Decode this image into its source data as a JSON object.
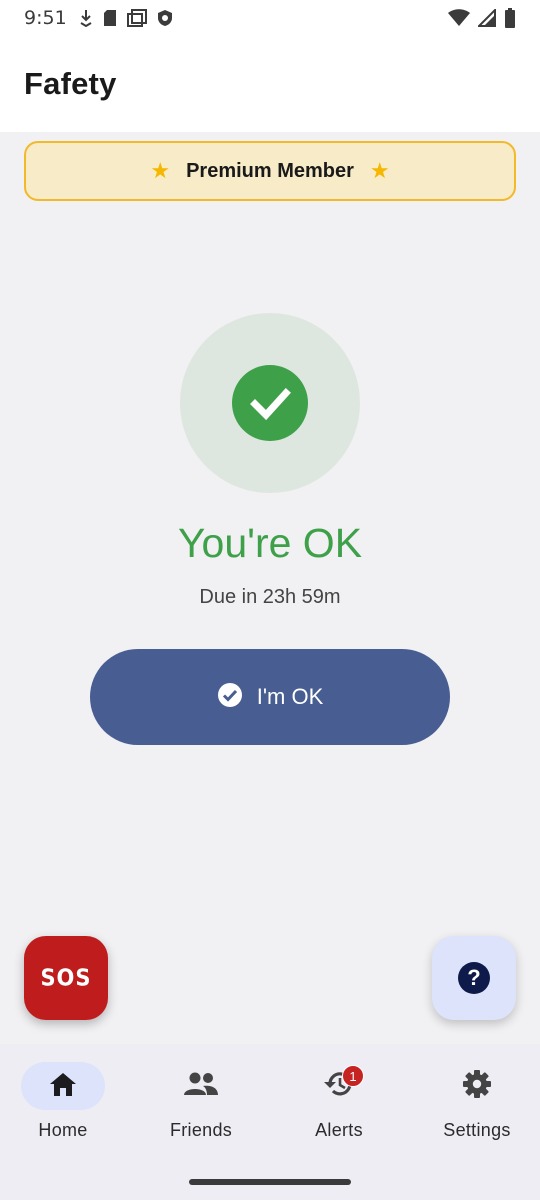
{
  "status_bar": {
    "time": "9:51",
    "left_icons": [
      "download-icon",
      "sd-card-icon",
      "screen-icon",
      "shield-icon"
    ],
    "right_icons": [
      "wifi-icon",
      "signal-icon",
      "battery-icon"
    ]
  },
  "app_bar": {
    "title": "Fafety"
  },
  "premium": {
    "label": "Premium Member",
    "icon": "star-icon",
    "accent": "#f2b92b",
    "background": "#f7ebc8"
  },
  "status": {
    "icon": "check-circle-icon",
    "title": "You're OK",
    "due": "Due in 23h 59m",
    "color": "#3fa04a"
  },
  "ok_button": {
    "label": "I'm OK",
    "icon": "check-circle-icon",
    "color": "#485d92"
  },
  "sos_button": {
    "label": "SOS",
    "color": "#bf1d1d"
  },
  "help_button": {
    "icon": "help-icon",
    "glyph": "?"
  },
  "bottom_nav": {
    "items": [
      {
        "label": "Home",
        "icon": "home-icon",
        "active": true
      },
      {
        "label": "Friends",
        "icon": "people-icon",
        "active": false
      },
      {
        "label": "Alerts",
        "icon": "history-icon",
        "active": false,
        "badge": "1"
      },
      {
        "label": "Settings",
        "icon": "gear-icon",
        "active": false
      }
    ]
  }
}
